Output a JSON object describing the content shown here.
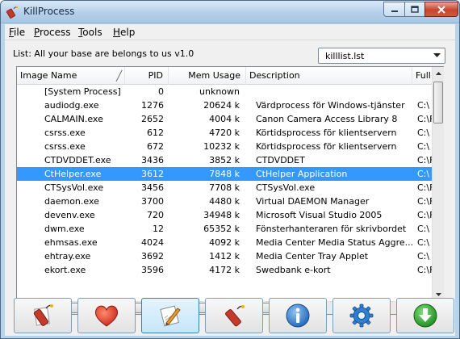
{
  "window": {
    "title": "KillProcess"
  },
  "menu": [
    {
      "first": "F",
      "rest": "ile"
    },
    {
      "first": "P",
      "rest": "rocess"
    },
    {
      "first": "T",
      "rest": "ools"
    },
    {
      "first": "H",
      "rest": "elp"
    }
  ],
  "list_label": "List: All your base are belongs to us v1.0",
  "list_select": {
    "value": "killlist.lst"
  },
  "columns": [
    "Image Name",
    "PID",
    "Mem Usage",
    "Description",
    "Full"
  ],
  "rows": [
    {
      "name": "[System Process]",
      "pid": "0",
      "mem": "unknown",
      "desc": "",
      "full": ""
    },
    {
      "name": "audiodg.exe",
      "pid": "1276",
      "mem": "20624 k",
      "desc": "Värdprocess för Windows-tjänster",
      "full": "C:\\"
    },
    {
      "name": "CALMAIN.exe",
      "pid": "2652",
      "mem": "4004 k",
      "desc": "Canon Camera Access Library 8",
      "full": "C:\\F"
    },
    {
      "name": "csrss.exe",
      "pid": "612",
      "mem": "4720 k",
      "desc": "Körtidsprocess för klientservern",
      "full": "C:\\"
    },
    {
      "name": "csrss.exe",
      "pid": "672",
      "mem": "10232 k",
      "desc": "Körtidsprocess för klientservern",
      "full": "C:\\"
    },
    {
      "name": "CTDVDDET.exe",
      "pid": "3436",
      "mem": "3852 k",
      "desc": "CTDVDDET",
      "full": "C:\\F"
    },
    {
      "name": "CtHelper.exe",
      "pid": "3612",
      "mem": "7848 k",
      "desc": "CtHelper Application",
      "full": "C:\\"
    },
    {
      "name": "CTSysVol.exe",
      "pid": "3456",
      "mem": "7708 k",
      "desc": "CTSysVol.exe",
      "full": "C:\\F"
    },
    {
      "name": "daemon.exe",
      "pid": "3700",
      "mem": "4480 k",
      "desc": "Virtual DAEMON Manager",
      "full": "C:\\F"
    },
    {
      "name": "devenv.exe",
      "pid": "720",
      "mem": "34948 k",
      "desc": "Microsoft Visual Studio 2005",
      "full": "C:\\F"
    },
    {
      "name": "dwm.exe",
      "pid": "12",
      "mem": "65352 k",
      "desc": "Fönsterhanteraren för skrivbordet",
      "full": "C:\\"
    },
    {
      "name": "ehmsas.exe",
      "pid": "4024",
      "mem": "4092 k",
      "desc": "Media Center Media Status Aggre...",
      "full": "C:\\"
    },
    {
      "name": "ehtray.exe",
      "pid": "3692",
      "mem": "1412 k",
      "desc": "Media Center Tray Applet",
      "full": "C:\\"
    },
    {
      "name": "ekort.exe",
      "pid": "3596",
      "mem": "4172 k",
      "desc": "Swedbank e-kort",
      "full": "C:\\F"
    }
  ],
  "selected_row": 6,
  "toolbar": [
    {
      "icon": "kill-process-icon"
    },
    {
      "icon": "heart-icon"
    },
    {
      "icon": "edit-list-icon"
    },
    {
      "icon": "dynamite-icon"
    },
    {
      "icon": "info-icon"
    },
    {
      "icon": "settings-gear-icon"
    },
    {
      "icon": "download-arrow-icon"
    }
  ],
  "colors": {
    "selection": "#3399ff",
    "titlebar": "#b6d0ea",
    "close_button": "#c8442c",
    "face": "#f0f0f0"
  }
}
